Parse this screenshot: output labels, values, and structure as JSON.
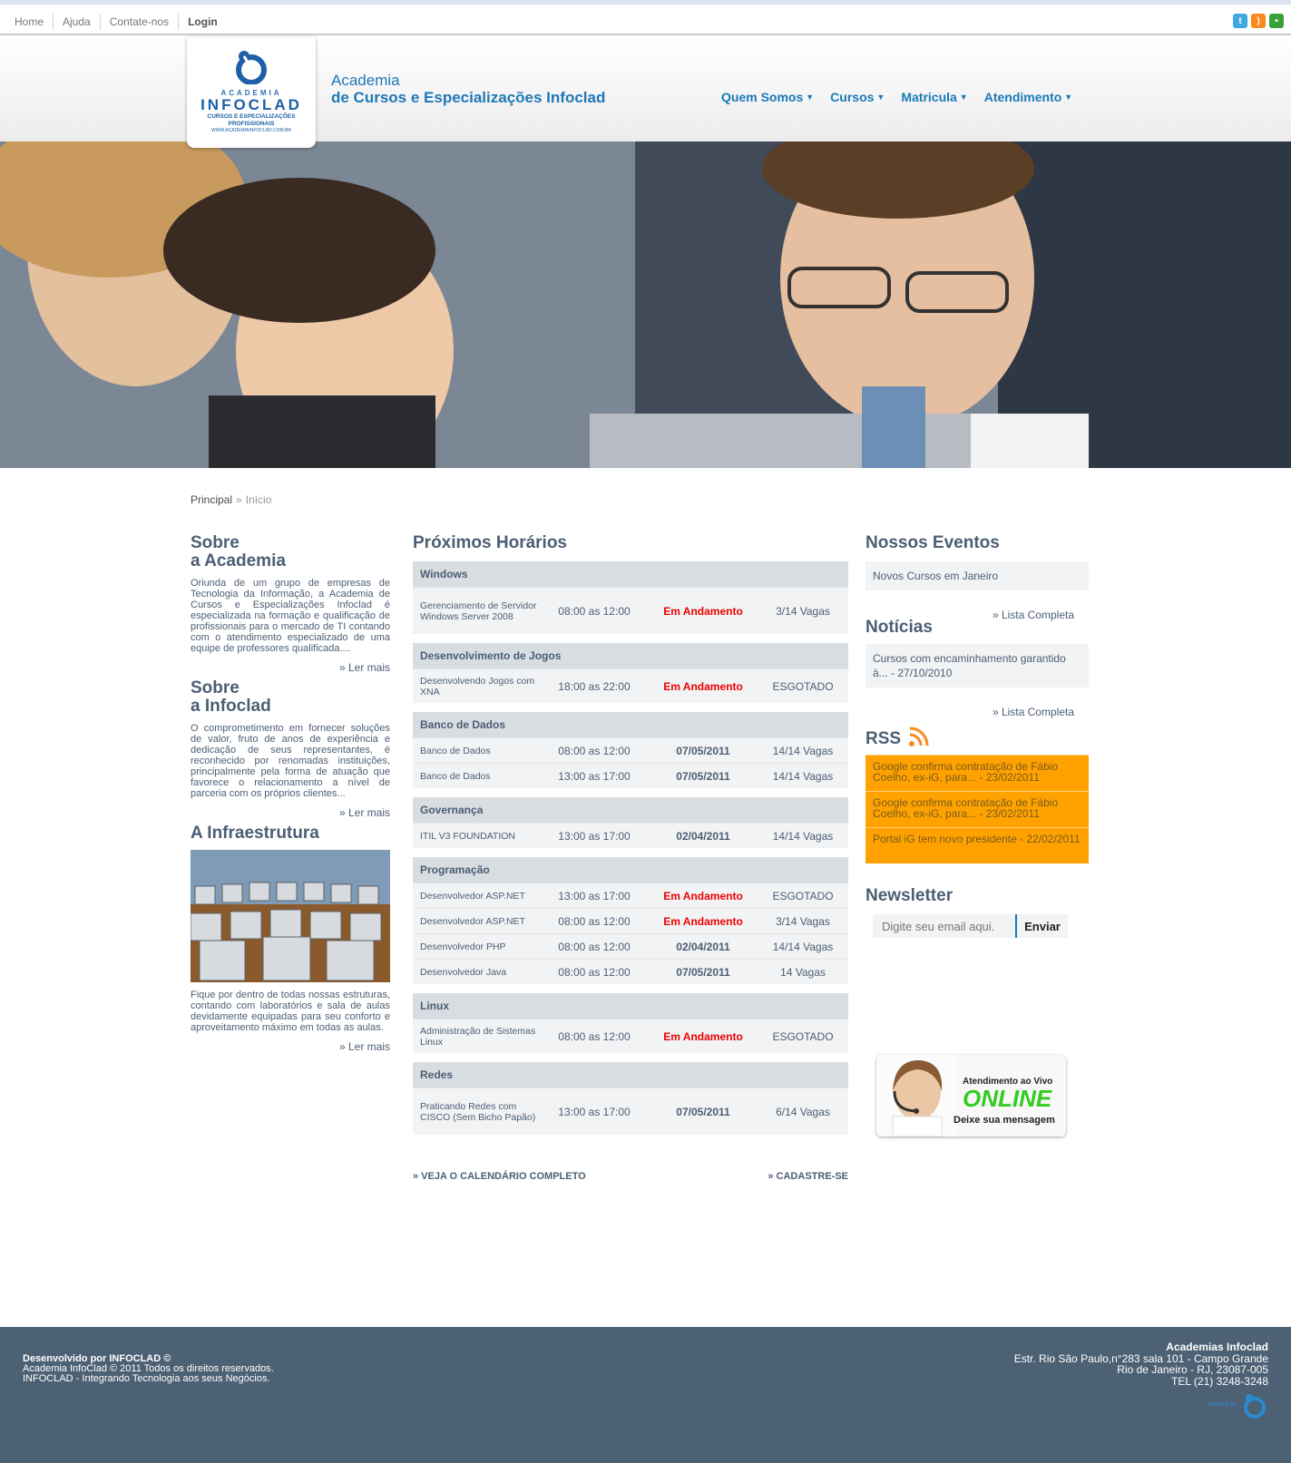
{
  "topbar": {
    "links": [
      "Home",
      "Ajuda",
      "Contate-nos",
      "Login"
    ],
    "social_icons": [
      "twitter-icon",
      "rss-icon",
      "chat-icon"
    ]
  },
  "header": {
    "logo": {
      "line1": "ACADEMIA",
      "line2": "INFOCLAD",
      "line3": "CURSOS E ESPECIALIZAÇÕES PROFISSIONAIS",
      "line4": "WWW.ACADEMIAINFOCLAD.COM.BR"
    },
    "site_name_line1": "Academia",
    "site_name_line2": "de Cursos e Especializações Infoclad",
    "nav": [
      "Quem Somos",
      "Cursos",
      "Matricula",
      "Atendimento"
    ]
  },
  "breadcrumb": {
    "root": "Principal",
    "separator": "»",
    "current": "Início"
  },
  "left": {
    "about_title_1": "Sobre",
    "about_title_2": "a Academia",
    "about_text": "Oriunda de um grupo de empresas de Tecnologia da Informação, a Academia de Cursos e Especializações Infoclad é especializada na formação e qualificação de profissionais para o mercado de TI contando com o atendimento especializado de uma equipe de professores qualificada....",
    "more_1": "» Ler mais",
    "infoclad_title_1": "Sobre",
    "infoclad_title_2": "a Infoclad",
    "infoclad_text": "O comprometimento em fornecer soluções de valor, fruto de anos de experiência e dedicação de seus representantes, é reconhecido por renomadas instituições, principalmente pela forma de atuação que favorece o relacionamento a nível de parceria com os próprios clientes...",
    "more_2": "» Ler mais",
    "infra_title": "A Infraestrutura",
    "infra_text": "Fique por dentro de todas nossas estruturas, contando com laboratórios e sala de aulas devidamente equipadas para seu conforto e aproveitamento máximo em todas as aulas.",
    "more_3": "» Ler mais"
  },
  "schedule": {
    "title": "Próximos Horários",
    "groups": [
      {
        "name": "Windows",
        "rows": [
          {
            "course": "Gerenciamento de Servidor Windows Server 2008",
            "time": "08:00 as 12:00",
            "status": "Em Andamento",
            "status_red": true,
            "vacancies": "3/14 Vagas"
          }
        ]
      },
      {
        "name": "Desenvolvimento de Jogos",
        "rows": [
          {
            "course": "Desenvolvendo Jogos com XNA",
            "time": "18:00 as 22:00",
            "status": "Em Andamento",
            "status_red": true,
            "vacancies": "ESGOTADO"
          }
        ]
      },
      {
        "name": "Banco de Dados",
        "rows": [
          {
            "course": "Banco de Dados",
            "time": "08:00 as 12:00",
            "status": "07/05/2011",
            "status_red": false,
            "vacancies": "14/14 Vagas"
          },
          {
            "course": "Banco de Dados",
            "time": "13:00 as 17:00",
            "status": "07/05/2011",
            "status_red": false,
            "vacancies": "14/14 Vagas"
          }
        ]
      },
      {
        "name": "Governança",
        "rows": [
          {
            "course": "ITIL V3 FOUNDATION",
            "time": "13:00 as 17:00",
            "status": "02/04/2011",
            "status_red": false,
            "vacancies": "14/14 Vagas"
          }
        ]
      },
      {
        "name": "Programação",
        "rows": [
          {
            "course": "Desenvolvedor ASP.NET",
            "time": "13:00 as 17:00",
            "status": "Em Andamento",
            "status_red": true,
            "vacancies": "ESGOTADO"
          },
          {
            "course": "Desenvolvedor ASP.NET",
            "time": "08:00 as 12:00",
            "status": "Em Andamento",
            "status_red": true,
            "vacancies": "3/14 Vagas"
          },
          {
            "course": "Desenvolvedor PHP",
            "time": "08:00 as 12:00",
            "status": "02/04/2011",
            "status_red": false,
            "vacancies": "14/14 Vagas"
          },
          {
            "course": "Desenvolvedor Java",
            "time": "08:00 as 12:00",
            "status": "07/05/2011",
            "status_red": false,
            "vacancies": "14 Vagas"
          }
        ]
      },
      {
        "name": "Linux",
        "rows": [
          {
            "course": "Administração de Sistemas Linux",
            "time": "08:00 as 12:00",
            "status": "Em Andamento",
            "status_red": true,
            "vacancies": "ESGOTADO"
          }
        ]
      },
      {
        "name": "Redes",
        "rows": [
          {
            "course": "Praticando Redes com CISCO (Sem Bicho Papão)",
            "time": "13:00 as 17:00",
            "status": "07/05/2011",
            "status_red": false,
            "vacancies": "6/14 Vagas"
          }
        ]
      }
    ],
    "calendar_link": "» VEJA O CALENDÁRIO COMPLETO",
    "signup_link": "» CADASTRE-SE"
  },
  "right": {
    "events_title": "Nossos Eventos",
    "event_item": "Novos Cursos em Janeiro",
    "full_list_1": "» Lista Completa",
    "news_title": "Notícias",
    "news_item": "Cursos com encaminhamento garantido à... - 27/10/2010",
    "full_list_2": "» Lista Completa",
    "rss_title": "RSS",
    "rss_items": [
      "Google confirma contratação de Fábio Coelho, ex-iG, para... - 23/02/2011",
      "Google confirma contratação de Fábio Coelho, ex-iG, para... - 23/02/2011",
      "Portal iG tem novo presidente - 22/02/2011"
    ],
    "newsletter_title": "Newsletter",
    "newsletter_placeholder": "Digite seu email aqui.",
    "newsletter_button": "Enviar",
    "live_line1": "Atendimento ao Vivo",
    "live_line2": "ONLINE",
    "live_line3": "Deixe sua mensagem"
  },
  "footer": {
    "left_line1": "Desenvolvido por INFOCLAD ©",
    "left_line2": "Academia InfoClad © 2011 Todos os direitos reservados.",
    "left_line3": "INFOCLAD - Integrando Tecnologia aos seus Negócios.",
    "right_line1": "Academias Infoclad",
    "right_line2": "Estr. Rio São Paulo,n°283 sala 101 - Campo Grande",
    "right_line3": "Rio de Janeiro - RJ, 23087-005",
    "right_line4": "TEL (21) 3248-3248",
    "powered": "Hosted by"
  },
  "colors": {
    "accent": "#1a79b9",
    "heading": "#4c5e74",
    "status_red": "#ee0000",
    "rss_bg": "#ffa200",
    "footer_bg": "#4d6174"
  }
}
